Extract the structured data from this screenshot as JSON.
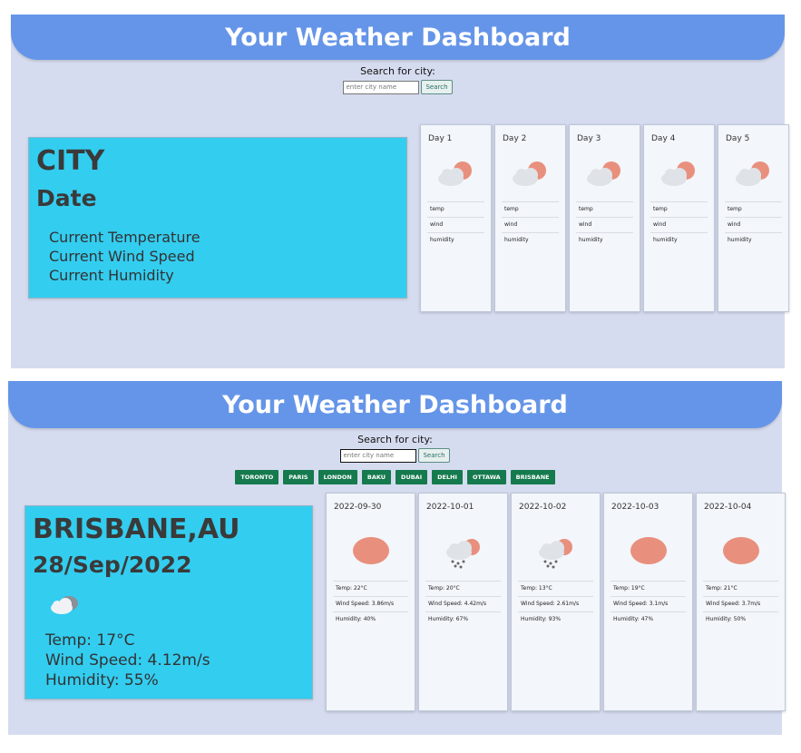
{
  "top": {
    "title": "Your Weather Dashboard",
    "search": {
      "label": "Search for city:",
      "placeholder": "enter city name",
      "button": "Search"
    },
    "current": {
      "city": "CITY",
      "date": "Date",
      "temp": "Current Temperature",
      "wind": "Current Wind Speed",
      "humidity": "Current Humidity"
    },
    "forecast": [
      {
        "day": "Day 1",
        "temp": "temp",
        "wind": "wind",
        "humidity": "humidity",
        "icon": "partly-cloudy-icon"
      },
      {
        "day": "Day 2",
        "temp": "temp",
        "wind": "wind",
        "humidity": "humidity",
        "icon": "partly-cloudy-icon"
      },
      {
        "day": "Day 3",
        "temp": "temp",
        "wind": "wind",
        "humidity": "humidity",
        "icon": "partly-cloudy-icon"
      },
      {
        "day": "Day 4",
        "temp": "temp",
        "wind": "wind",
        "humidity": "humidity",
        "icon": "partly-cloudy-icon"
      },
      {
        "day": "Day 5",
        "temp": "temp",
        "wind": "wind",
        "humidity": "humidity",
        "icon": "partly-cloudy-icon"
      }
    ]
  },
  "bottom": {
    "title": "Your Weather Dashboard",
    "search": {
      "label": "Search for city:",
      "placeholder": "enter city name",
      "button": "Search"
    },
    "cities": [
      "TORONTO",
      "PARIS",
      "LONDON",
      "BAKU",
      "DUBAI",
      "DELHI",
      "OTTAWA",
      "BRISBANE"
    ],
    "current": {
      "city": "BRISBANE,AU",
      "date": "28/Sep/2022",
      "icon": "cloudy-icon",
      "temp": "Temp: 17°C",
      "wind": "Wind Speed: 4.12m/s",
      "humidity": "Humidity: 55%"
    },
    "forecast": [
      {
        "day": "2022-09-30",
        "icon": "sun-icon",
        "temp": "Temp: 22°C",
        "wind": "Wind Speed: 3.86m/s",
        "humidity": "Humidity: 40%"
      },
      {
        "day": "2022-10-01",
        "icon": "snow-icon",
        "temp": "Temp: 20°C",
        "wind": "Wind Speed: 4.42m/s",
        "humidity": "Humidity: 67%"
      },
      {
        "day": "2022-10-02",
        "icon": "snow-icon",
        "temp": "Temp: 13°C",
        "wind": "Wind Speed: 2.61m/s",
        "humidity": "Humidity: 93%"
      },
      {
        "day": "2022-10-03",
        "icon": "sun-icon",
        "temp": "Temp: 19°C",
        "wind": "Wind Speed: 3.1m/s",
        "humidity": "Humidity: 47%"
      },
      {
        "day": "2022-10-04",
        "icon": "sun-icon",
        "temp": "Temp: 21°C",
        "wind": "Wind Speed: 3.7m/s",
        "humidity": "Humidity: 50%"
      }
    ]
  },
  "colors": {
    "panel_bg": "#d6dcef",
    "header_bg": "#6595e8",
    "current_bg": "#33cdf0",
    "city_button_bg": "#157a4e",
    "sun": "#e8907d"
  }
}
